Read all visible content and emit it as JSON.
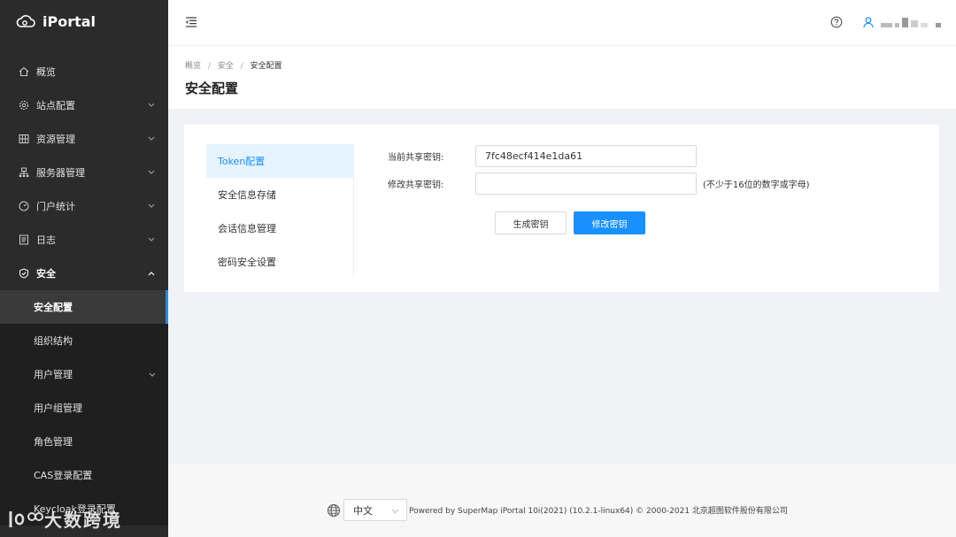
{
  "app": {
    "name": "iPortal"
  },
  "sidebar": {
    "items": [
      {
        "label": "概览",
        "icon": "home-icon",
        "has_arrow": false
      },
      {
        "label": "站点配置",
        "icon": "gear-icon",
        "has_arrow": true
      },
      {
        "label": "资源管理",
        "icon": "grid-icon",
        "has_arrow": true
      },
      {
        "label": "服务器管理",
        "icon": "server-icon",
        "has_arrow": true
      },
      {
        "label": "门户统计",
        "icon": "dashboard-icon",
        "has_arrow": true
      },
      {
        "label": "日志",
        "icon": "log-icon",
        "has_arrow": true
      },
      {
        "label": "安全",
        "icon": "shield-icon",
        "has_arrow": true,
        "open": true
      }
    ],
    "sub_items": [
      {
        "label": "安全配置",
        "active": true
      },
      {
        "label": "组织结构"
      },
      {
        "label": "用户管理",
        "has_arrow": true
      },
      {
        "label": "用户组管理"
      },
      {
        "label": "角色管理"
      },
      {
        "label": "CAS登录配置"
      },
      {
        "label": "Keycloak登录配置"
      }
    ]
  },
  "header": {
    "fold_icon": "menu-fold-icon",
    "help_icon": "question-circle-icon",
    "user_icon": "user-icon"
  },
  "breadcrumb": {
    "items": [
      "概览",
      "安全",
      "安全配置"
    ],
    "sep": "/"
  },
  "page": {
    "title": "安全配置"
  },
  "tabs": [
    "Token配置",
    "安全信息存储",
    "会话信息管理",
    "密码安全设置"
  ],
  "form": {
    "current_key_label": "当前共享密钥:",
    "current_key_value": "7fc48ecf414e1da61",
    "new_key_label": "修改共享密钥:",
    "new_key_value": "",
    "new_key_hint": "(不少于16位的数字或字母)",
    "generate_button": "生成密钥",
    "modify_button": "修改密钥"
  },
  "footer": {
    "language": "中文",
    "copyright": "Powered by SuperMap iPortal 10i(2021) (10.2.1-linux64) © 2000-2021 北京超图软件股份有限公司"
  },
  "watermark": {
    "text": "大数跨境"
  },
  "colors": {
    "sidebar_bg": "#2b2b2b",
    "accent": "#1890ff",
    "active_tab_bg": "#e6f4ff"
  }
}
